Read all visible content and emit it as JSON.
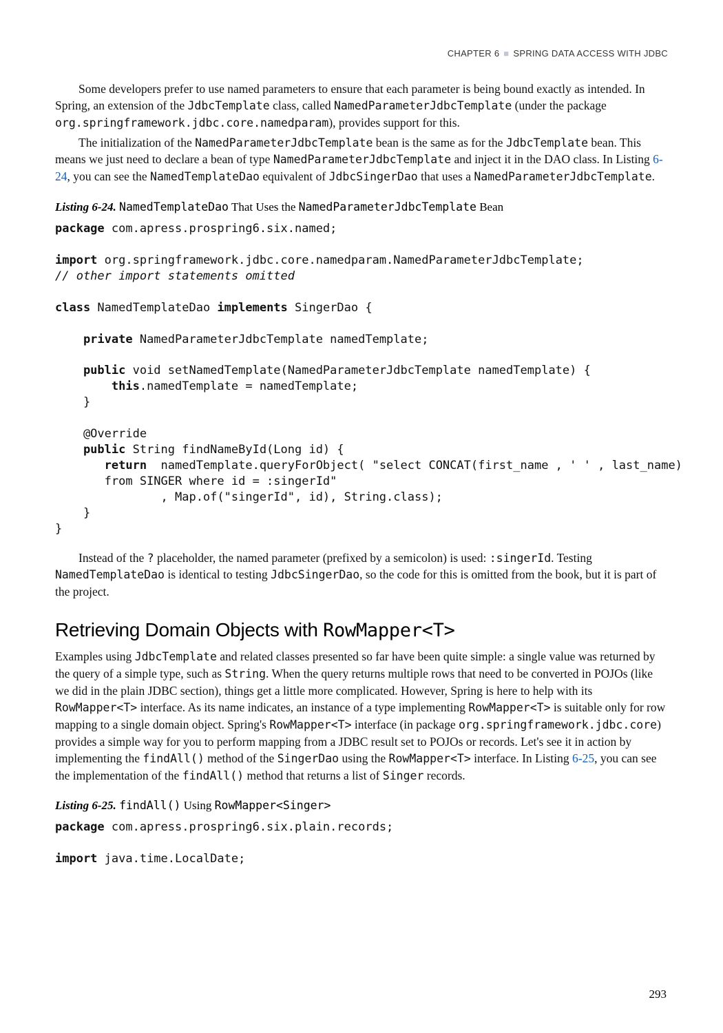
{
  "header": {
    "chapter_label": "CHAPTER 6",
    "chapter_title": "SPRING DATA ACCESS WITH JDBC"
  },
  "para1_a": "Some developers prefer to use named parameters to ensure that each parameter is being bound exactly as intended. In Spring, an extension of the ",
  "para1_b": " class, called ",
  "para1_c": " (under the package ",
  "para1_d": "), provides support for this.",
  "inline": {
    "JdbcTemplate": "JdbcTemplate",
    "NamedParameterJdbcTemplate": "NamedParameterJdbcTemplate",
    "pkg_namedparam": "org.springframework.jdbc.core.namedparam",
    "NamedTemplateDao": "NamedTemplateDao",
    "JdbcSingerDao": "JdbcSingerDao",
    "singerId_placeholder": ":singerId",
    "question": "?",
    "String": "String",
    "RowMapperT": "RowMapper<T>",
    "RowMapperSinger": "RowMapper<Singer>",
    "pkg_core": "org.springframework.jdbc.core",
    "findAll": "findAll()",
    "SingerDao": "SingerDao",
    "Singer": "Singer"
  },
  "para2_a": "The initialization of the ",
  "para2_b": " bean is the same as for the ",
  "para2_c": " bean. This means we just need to declare a bean of type ",
  "para2_d": " and inject it in the DAO class. In Listing ",
  "para2_e": ", you can see the ",
  "para2_f": " equivalent of ",
  "para2_g": " that uses a ",
  "para2_h": ".",
  "link_6_24": "6-24",
  "listing624": {
    "label": "Listing 6-24.",
    "caption_a": " That Uses the ",
    "caption_b": " Bean"
  },
  "code624": {
    "l1a": "package",
    "l1b": " com.apress.prospring6.six.named;",
    "l2": "",
    "l3a": "import",
    "l3b": " org.springframework.jdbc.core.namedparam.NamedParameterJdbcTemplate;",
    "l4": "// other import statements omitted",
    "l5": "",
    "l6a": "class",
    "l6b": " NamedTemplateDao ",
    "l6c": "implements",
    "l6d": " SingerDao {",
    "l7": "",
    "l8a": "    private",
    "l8b": " NamedParameterJdbcTemplate namedTemplate;",
    "l9": "",
    "l10a": "    public",
    "l10b": " void setNamedTemplate(NamedParameterJdbcTemplate namedTemplate) {",
    "l11a": "        this",
    "l11b": ".namedTemplate = namedTemplate;",
    "l12": "    }",
    "l13": "",
    "l14": "    @Override",
    "l15a": "    public",
    "l15b": " String findNameById(Long id) {",
    "l16a": "       return",
    "l16b": "  namedTemplate.queryForObject( \"select CONCAT(first_name , ' ' , last_name)",
    "l17": "       from SINGER where id = :singerId\"",
    "l18": "               , Map.of(\"singerId\", id), String.class);",
    "l19": "    }",
    "l20": "}"
  },
  "para3_a": "Instead of the ",
  "para3_b": " placeholder, the named parameter (prefixed by a semicolon) is used: ",
  "para3_c": ". Testing ",
  "para3_d": " is identical to testing ",
  "para3_e": ", so the code for this is omitted from the book, but it is part of the project.",
  "section_heading_text": "Retrieving Domain Objects with ",
  "para4_a": "Examples using ",
  "para4_b": " and related classes presented so far have been quite simple: a single value was returned by the query of a simple type, such as ",
  "para4_c": ". When the query returns multiple rows that need to be converted in POJOs (like we did in the plain JDBC section), things get a little more complicated. However, Spring is here to help with its ",
  "para4_d": " interface. As its name indicates, an instance of a type implementing ",
  "para4_e": " is suitable only for row mapping to a single domain object. Spring's ",
  "para4_f": " interface (in package ",
  "para4_g": ") provides a simple way for you to perform mapping from a JDBC result set to POJOs or records. Let's see it in action by implementing the ",
  "para4_h": " method of the ",
  "para4_i": " using the ",
  "para4_j": " interface. In Listing ",
  "para4_k": ", you can see the implementation of the ",
  "para4_l": " method that returns a list of ",
  "para4_m": " records.",
  "link_6_25": "6-25",
  "listing625": {
    "label": "Listing 6-25.",
    "caption_a": " Using "
  },
  "code625": {
    "l1a": "package",
    "l1b": " com.apress.prospring6.six.plain.records;",
    "l2": "",
    "l3a": "import",
    "l3b": " java.time.LocalDate;"
  },
  "page_number": "293"
}
